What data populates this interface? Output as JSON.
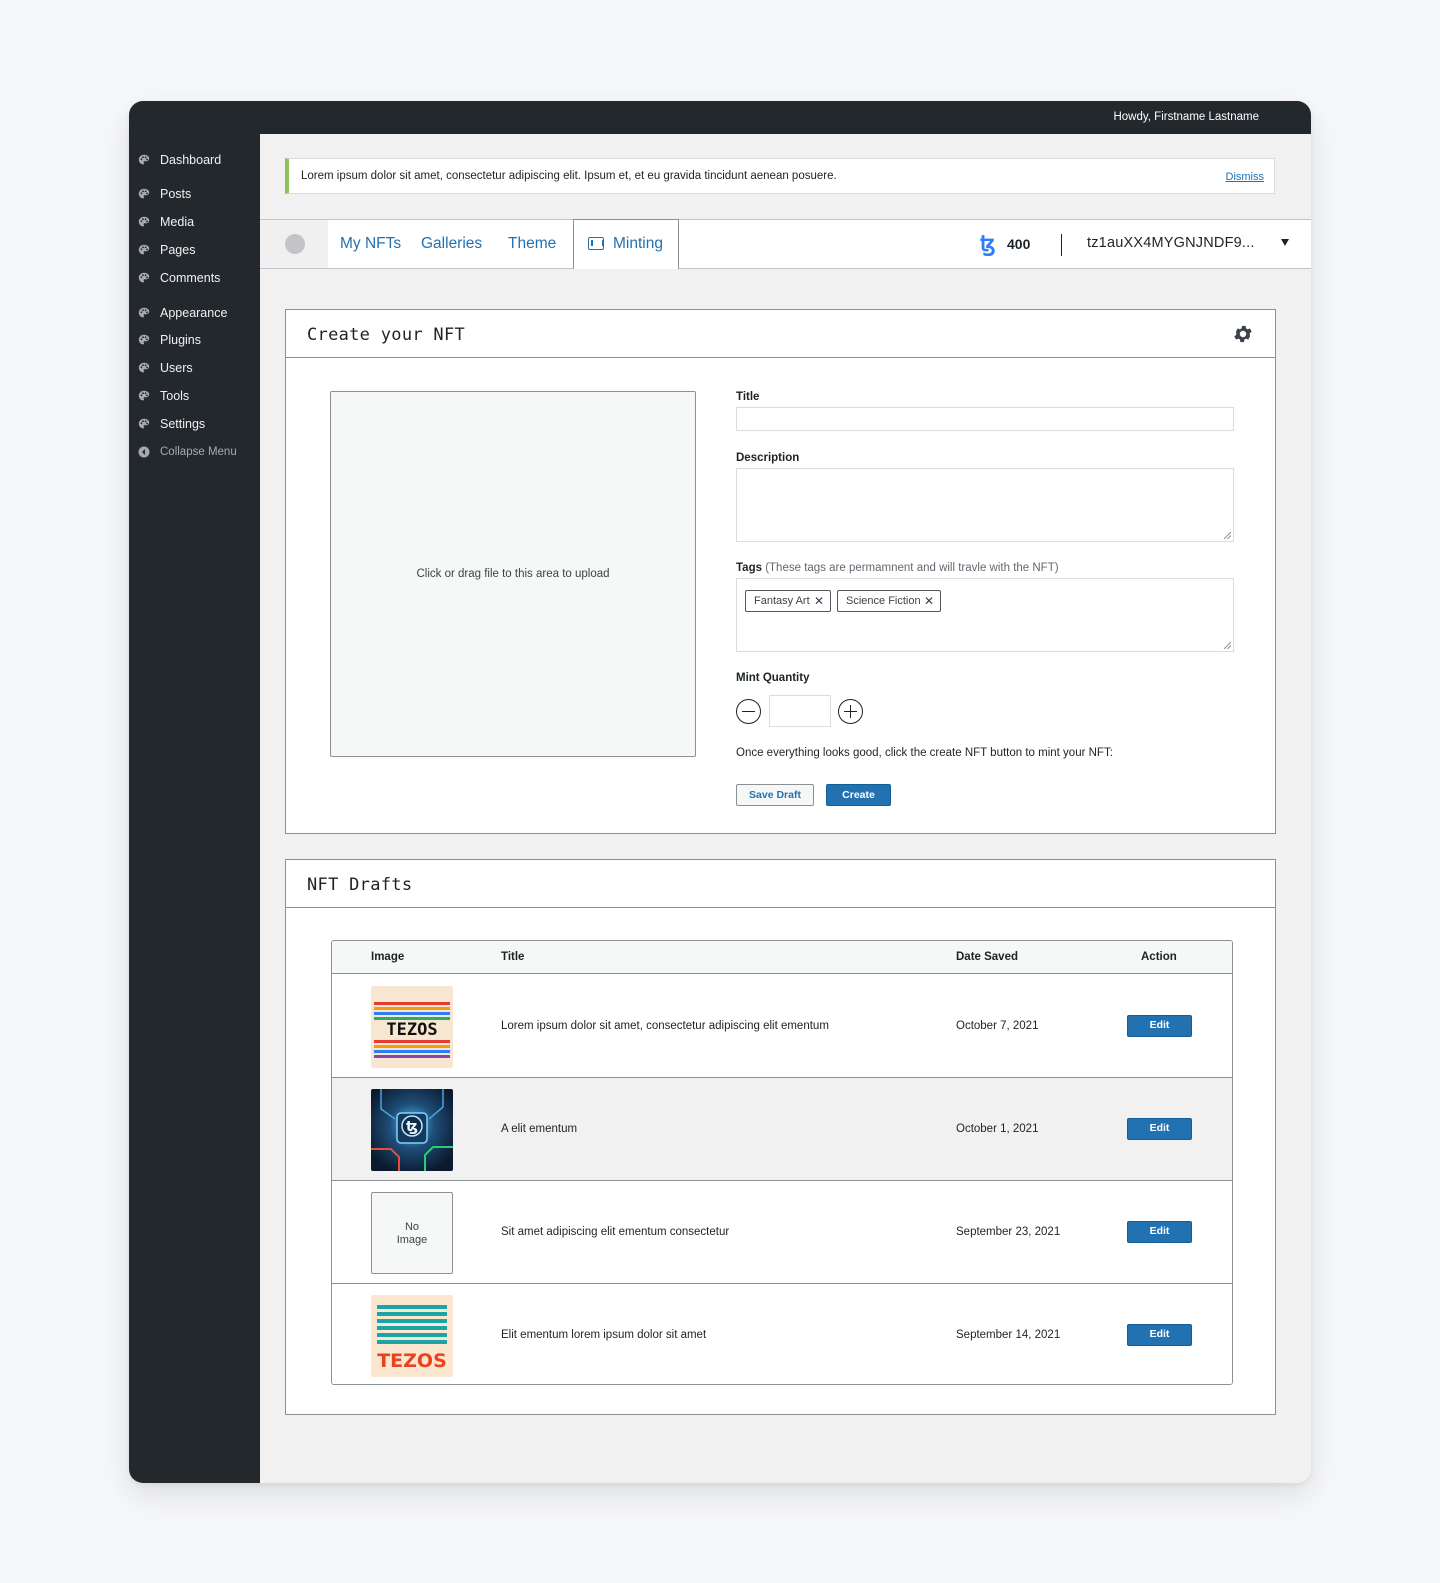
{
  "admin_bar": {
    "greeting": "Howdy, Firstname Lastname"
  },
  "sidebar": {
    "items": [
      {
        "label": "Dashboard",
        "icon": "palette-icon"
      },
      {
        "label": "Posts",
        "icon": "palette-icon"
      },
      {
        "label": "Media",
        "icon": "palette-icon"
      },
      {
        "label": "Pages",
        "icon": "palette-icon"
      },
      {
        "label": "Comments",
        "icon": "palette-icon"
      },
      {
        "label": "Appearance",
        "icon": "palette-icon"
      },
      {
        "label": "Plugins",
        "icon": "palette-icon"
      },
      {
        "label": "Users",
        "icon": "palette-icon"
      },
      {
        "label": "Tools",
        "icon": "palette-icon"
      },
      {
        "label": "Settings",
        "icon": "palette-icon"
      }
    ],
    "collapse_label": "Collapse Menu"
  },
  "notice": {
    "text": "Lorem ipsum dolor sit amet, consectetur adipiscing elit. Ipsum et, et eu gravida tincidunt aenean posuere.",
    "dismiss_label": "Dismiss",
    "accent_color": "#8fc25a"
  },
  "nav": {
    "tabs": [
      "My NFTs",
      "Galleries",
      "Theme",
      "Minting"
    ],
    "active_tab": "Minting",
    "balance": "400",
    "currency_icon": "tezos-icon",
    "wallet_address": "tz1auXX4MYGNJNDF9..."
  },
  "create_panel": {
    "title": "Create your NFT",
    "upload_text": "Click or drag file to this area to upload",
    "title_label": "Title",
    "title_value": "",
    "description_label": "Description",
    "description_value": "",
    "tags_label": "Tags",
    "tags_hint": "(These tags are permamnent and will travle with the NFT)",
    "tags": [
      "Fantasy Art",
      "Science Fiction"
    ],
    "mint_quantity_label": "Mint Quantity",
    "mint_quantity_value": "",
    "helper_text": "Once everything looks good, click the create NFT button to mint your NFT:",
    "save_draft_label": "Save Draft",
    "create_label": "Create"
  },
  "drafts_panel": {
    "title": "NFT Drafts",
    "columns": [
      "Image",
      "Title",
      "Date Saved",
      "Action"
    ],
    "rows": [
      {
        "image": "tezos-rainbow-stripes-thumbnail",
        "title": "Lorem ipsum dolor sit amet, consectetur adipiscing elit ementum",
        "date": "October 7, 2021",
        "action": "Edit"
      },
      {
        "image": "tezos-circuit-board-thumbnail",
        "title": "A elit ementum",
        "date": "October 1, 2021",
        "action": "Edit"
      },
      {
        "image": "no-image-placeholder",
        "no_image_label": "No Image",
        "title": "Sit amet adipiscing elit ementum consectetur",
        "date": "September 23, 2021",
        "action": "Edit"
      },
      {
        "image": "tezos-teal-stripes-thumbnail",
        "title": "Elit ementum lorem ipsum dolor sit amet",
        "date": "September 14, 2021",
        "action": "Edit"
      }
    ]
  },
  "colors": {
    "admin_dark": "#23282d",
    "link_blue": "#2271b1",
    "primary_button": "#2271b1",
    "tezos_blue": "#2c7df7"
  }
}
